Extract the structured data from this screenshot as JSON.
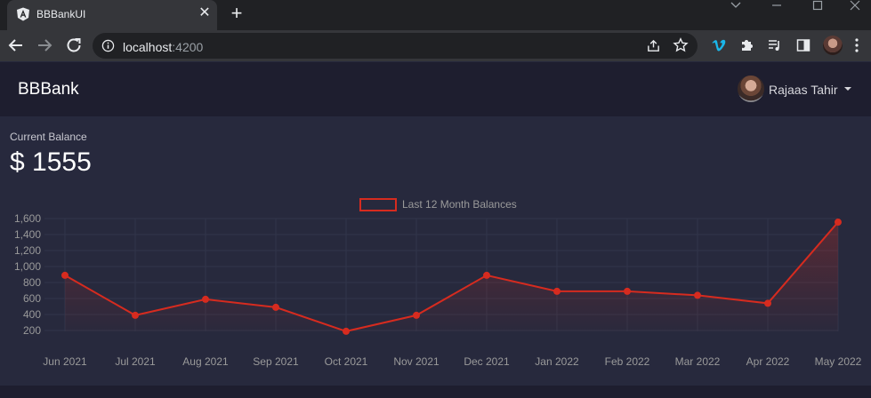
{
  "browser": {
    "tab_title": "BBBankUI",
    "tab_close": "✕",
    "new_tab": "+",
    "url_host": "localhost",
    "url_port": ":4200"
  },
  "navbar": {
    "brand": "BBBank",
    "user_name": "Rajaas Tahir"
  },
  "balance": {
    "label": "Current Balance",
    "value": "$ 1555"
  },
  "colors": {
    "line": "#d62b1f",
    "grid": "#32354a",
    "background": "#27293d"
  },
  "chart_data": {
    "type": "line",
    "legend": "Last 12 Month Balances",
    "legend_position": "top-center",
    "categories": [
      "Jun 2021",
      "Jul 2021",
      "Aug 2021",
      "Sep 2021",
      "Oct 2021",
      "Nov 2021",
      "Dec 2021",
      "Jan 2022",
      "Feb 2022",
      "Mar 2022",
      "Apr 2022",
      "May 2022"
    ],
    "series": [
      {
        "name": "Last 12 Month Balances",
        "values": [
          890,
          390,
          590,
          490,
          190,
          390,
          890,
          690,
          690,
          640,
          540,
          1555
        ]
      }
    ],
    "y_ticks": [
      "1,600",
      "1,400",
      "1,200",
      "1,000",
      "800",
      "600",
      "400",
      "200"
    ],
    "ylim": [
      200,
      1600
    ],
    "grid": true,
    "filled_area": true
  }
}
